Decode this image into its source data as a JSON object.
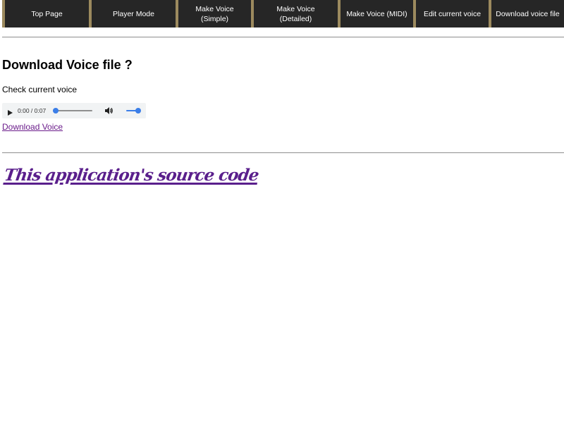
{
  "nav": {
    "items": [
      {
        "label": "Top Page"
      },
      {
        "label": "Player Mode"
      },
      {
        "label": "Make Voice (Simple)"
      },
      {
        "label": "Make Voice (Detailed)"
      },
      {
        "label": "Make Voice (MIDI)"
      },
      {
        "label": "Edit current voice"
      },
      {
        "label": "Download voice file"
      }
    ],
    "colors": {
      "background": "#262626",
      "border": "#9c8a5e",
      "text": "#ffffff"
    }
  },
  "main": {
    "heading": "Download Voice file ?",
    "check_label": "Check current voice",
    "audio_player": {
      "time_display": "0:00 / 0:07",
      "position": 0.0,
      "volume": 1.0,
      "play_icon": "play-icon",
      "volume_icon": "volume-icon",
      "accent_color": "#3b7ee8"
    },
    "download_link": "Download Voice"
  },
  "footer": {
    "source_link": "This application's source code",
    "link_color": "#5a1f8c"
  }
}
